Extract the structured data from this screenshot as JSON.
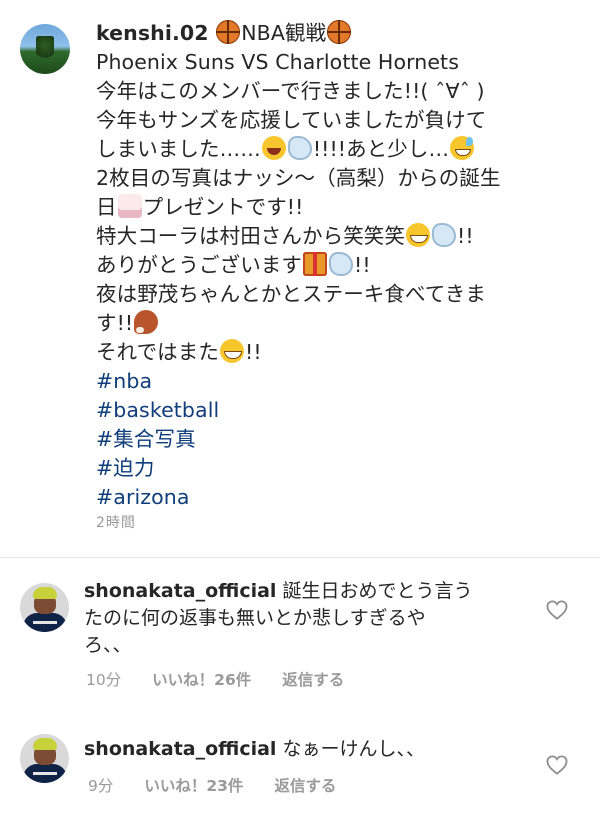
{
  "post": {
    "username": "kenshi.02",
    "caption_lines": [
      {
        "pre": "",
        "text_a": "NBA観戦",
        "tail": ""
      },
      "Phoenix Suns VS Charlotte Hornets",
      "今年はこのメンバーで行きました!!( ˆ∀ˆ )",
      "今年もサンズを応援していましたが負けて",
      {
        "a": "しまいました……",
        "b": "!!!!あと少し…"
      },
      "2枚目の写真はナッシ〜（高梨）からの誕生",
      {
        "a": "日",
        "b": "プレゼントです!!"
      },
      {
        "a": "特大コーラは村田さんから笑笑笑",
        "b": "!!"
      },
      {
        "a": "ありがとうございます",
        "b": "!!"
      },
      "夜は野茂ちゃんとかとステーキ食べてきま",
      {
        "a": "す!!"
      },
      {
        "a": "それではまた",
        "b": "!!"
      }
    ],
    "hashtags": [
      "#nba",
      "#basketball",
      "#集合写真",
      "#迫力",
      "#arizona"
    ],
    "timestamp": "2時間",
    "icons": {
      "basketball": "basketball-emoji",
      "laugh": "tears-of-joy-emoji",
      "dash": "dash-emoji",
      "sweat": "sweat-smile-emoji",
      "cake": "birthday-cake-emoji",
      "grin": "grinning-emoji",
      "gift": "gift-emoji",
      "meat": "meat-on-bone-emoji"
    }
  },
  "comments": [
    {
      "username": "shonakata_official",
      "text_lines": [
        "誕生日おめでとう言う",
        "たのに何の返事も無いとか悲しすぎるや",
        "ろ、、"
      ],
      "time": "10分",
      "likes": "いいね！26件",
      "reply": "返信する"
    },
    {
      "username": "shonakata_official",
      "text_lines": [
        "なぁーけんし、、"
      ],
      "time": "9分",
      "likes": "いいね！23件",
      "reply": "返信する"
    }
  ],
  "colors": {
    "hashtag": "#0f3d7a",
    "text": "#262626",
    "meta": "#9a9a9a"
  }
}
